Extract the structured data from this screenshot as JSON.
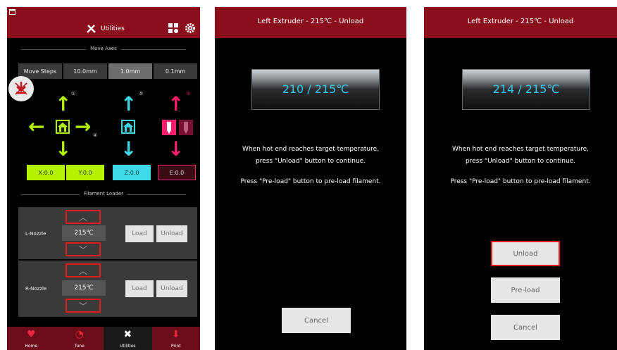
{
  "utilities": {
    "header": {
      "title": "Utilities",
      "icons": [
        "window-icon",
        "tools-icon",
        "filament-icon",
        "gear-icon"
      ]
    },
    "move_axes": {
      "label": "Move Axes",
      "steps_label": "Move Steps",
      "steps": [
        "10.0mm",
        "1.0mm",
        "0.1mm"
      ],
      "selected_step": "1.0mm",
      "axis_numbers": [
        "①",
        "②",
        "③",
        "④"
      ],
      "positions": [
        "X:0.0",
        "Y:0.0",
        "Z:0.0",
        "E:0.0"
      ]
    },
    "filament": {
      "label": "Filament Loader",
      "nozzles": [
        {
          "name": "L-Nozzle",
          "temp": "215℃",
          "load": "Load",
          "unload": "Unload"
        },
        {
          "name": "R-Nozzle",
          "temp": "215℃",
          "load": "Load",
          "unload": "Unload"
        }
      ]
    },
    "tabs": [
      {
        "label": "Home",
        "icon": "heart-icon"
      },
      {
        "label": "Tune",
        "icon": "gauge-icon"
      },
      {
        "label": "Utilities",
        "icon": "tools-icon"
      },
      {
        "label": "Print",
        "icon": "print-icon"
      }
    ],
    "colors": {
      "header": "#8a0e1c",
      "green": "#b5f200",
      "cyan": "#3fd8e6",
      "magenta": "#ff1e6e",
      "highlight": "#e01b1b"
    }
  },
  "unload_a": {
    "title": "Left Extruder - 215℃ - Unload",
    "temp": "210 / 215℃",
    "message1": "When hot end reaches target temperature,",
    "message2": "press \"Unload\" button to continue.",
    "message3": "Press \"Pre-load\" button to pre-load filament.",
    "cancel": "Cancel"
  },
  "unload_b": {
    "title": "Left Extruder - 215℃ - Unload",
    "temp": "214 / 215℃",
    "message1": "When hot end reaches target temperature,",
    "message2": "press \"Unload\" button to continue.",
    "message3": "Press \"Pre-load\" button to pre-load filament.",
    "unload": "Unload",
    "preload": "Pre-load",
    "cancel": "Cancel"
  }
}
